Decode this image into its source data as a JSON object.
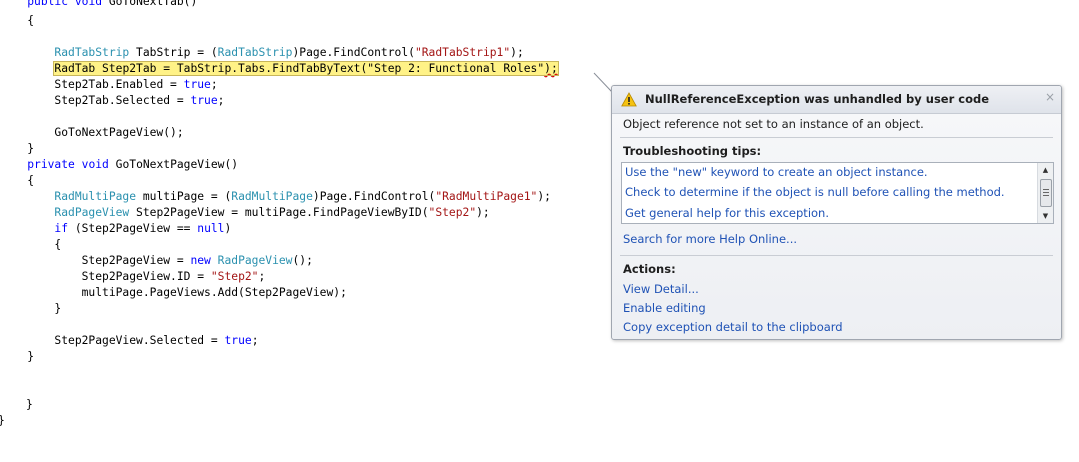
{
  "code": {
    "l1": {
      "indent": "    ",
      "k1": "public",
      "s1": " ",
      "k2": "void",
      "rest": " GoToNextTab()"
    },
    "l2": {
      "text": "    {"
    },
    "l3": {
      "indent": "        ",
      "t1": "RadTabStrip",
      "m1": " TabStrip = (",
      "t2": "RadTabStrip",
      "m2": ")Page.FindControl(",
      "s1": "\"RadTabStrip1\"",
      "end": ");"
    },
    "l4": {
      "indent": "        ",
      "t1": "RadTab",
      "m1": " Step2Tab = TabStrip.Tabs.FindTabByText(",
      "s1": "\"Step 2: Functional Roles\"",
      "end": ");"
    },
    "l5": {
      "indent": "        ",
      "m1": "Step2Tab.Enabled = ",
      "k1": "true",
      "end": ";"
    },
    "l6": {
      "indent": "        ",
      "m1": "Step2Tab.Selected = ",
      "k1": "true",
      "end": ";"
    },
    "l8": {
      "text": "        GoToNextPageView();"
    },
    "l9": {
      "text": "    }"
    },
    "l10": {
      "indent": "    ",
      "k1": "private",
      "s1": " ",
      "k2": "void",
      "rest": " GoToNextPageView()"
    },
    "l11": {
      "text": "    {"
    },
    "l12": {
      "indent": "        ",
      "t1": "RadMultiPage",
      "m1": " multiPage = (",
      "t2": "RadMultiPage",
      "m2": ")Page.FindControl(",
      "s1": "\"RadMultiPage1\"",
      "end": ");"
    },
    "l13": {
      "indent": "        ",
      "t1": "RadPageView",
      "m1": " Step2PageView = multiPage.FindPageViewByID(",
      "s1": "\"Step2\"",
      "end": ");"
    },
    "l14": {
      "indent": "        ",
      "k1": "if",
      "m1": " (Step2PageView == ",
      "k2": "null",
      "end": ")"
    },
    "l15": {
      "text": "        {"
    },
    "l16": {
      "indent": "            ",
      "m1": "Step2PageView = ",
      "k1": "new",
      "s1": " ",
      "t1": "RadPageView",
      "end": "();"
    },
    "l17": {
      "indent": "            ",
      "m1": "Step2PageView.ID = ",
      "s1": "\"Step2\"",
      "end": ";"
    },
    "l18": {
      "text": "            multiPage.PageViews.Add(Step2PageView);"
    },
    "l19": {
      "text": "        }"
    },
    "l21": {
      "indent": "        ",
      "m1": "Step2PageView.Selected = ",
      "k1": "true",
      "end": ";"
    },
    "l22": {
      "text": "    }"
    },
    "l25": {
      "text": "}"
    },
    "l26": {
      "text": "}"
    }
  },
  "popup": {
    "icon": "warning-icon",
    "title": "NullReferenceException was unhandled by user code",
    "close": "×",
    "message": "Object reference not set to an instance of an object.",
    "tips_title": "Troubleshooting tips:",
    "tips": [
      "Use the \"new\" keyword to create an object instance.",
      "Check to determine if the object is null before calling the method.",
      "Get general help for this exception."
    ],
    "search_link": "Search for more Help Online...",
    "actions_title": "Actions:",
    "actions": [
      "View Detail...",
      "Enable editing",
      "Copy exception detail to the clipboard"
    ]
  },
  "colors": {
    "keyword": "#0000ff",
    "type": "#2b91af",
    "string": "#a31515",
    "highlight": "#fff287",
    "link": "#1f52b5"
  }
}
